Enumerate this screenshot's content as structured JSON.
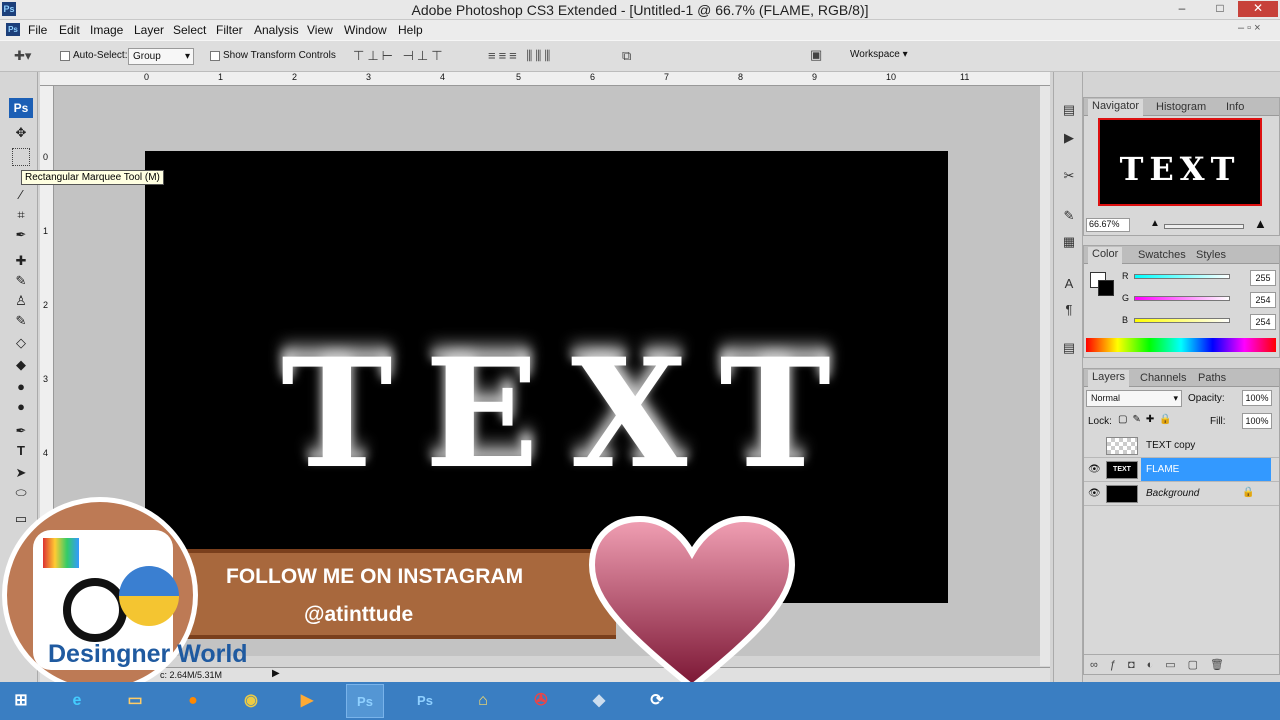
{
  "window": {
    "title": "Adobe Photoshop CS3 Extended - [Untitled-1 @ 66.7% (FLAME, RGB/8)]",
    "app_icon": "Ps"
  },
  "menu": [
    "File",
    "Edit",
    "Image",
    "Layer",
    "Select",
    "Filter",
    "Analysis",
    "View",
    "Window",
    "Help"
  ],
  "options": {
    "auto_select_label": "Auto-Select:",
    "auto_select_value": "Group",
    "transform_label": "Show Transform Controls",
    "workspace_label": "Workspace ▾"
  },
  "tools_logo": "Ps",
  "tooltip": "Rectangular Marquee Tool (M)",
  "ruler_top": [
    "0",
    "1",
    "2",
    "3",
    "4",
    "5",
    "6",
    "7",
    "8",
    "9",
    "10",
    "11"
  ],
  "ruler_left": [
    "0",
    "1",
    "2",
    "3",
    "4"
  ],
  "canvas": {
    "text": "TEXT"
  },
  "status": {
    "doc": "c: 2.64M/5.31M"
  },
  "navigator": {
    "tabs": [
      "Navigator",
      "Histogram",
      "Info"
    ],
    "preview_text": "TEXT",
    "zoom": "66.67%"
  },
  "color": {
    "tabs": [
      "Color",
      "Swatches",
      "Styles"
    ],
    "channels": [
      {
        "label": "R",
        "value": "255",
        "color": "#00e0e0"
      },
      {
        "label": "G",
        "value": "254",
        "color": "#e020e0"
      },
      {
        "label": "B",
        "value": "254",
        "color": "#e0e020"
      }
    ]
  },
  "layers": {
    "tabs": [
      "Layers",
      "Channels",
      "Paths"
    ],
    "blend": "Normal",
    "opacity_label": "Opacity:",
    "opacity": "100%",
    "lock_label": "Lock:",
    "fill_label": "Fill:",
    "fill": "100%",
    "rows": [
      {
        "name": "TEXT copy",
        "visible": false,
        "selected": false
      },
      {
        "name": "FLAME",
        "visible": true,
        "selected": true
      },
      {
        "name": "Background",
        "visible": true,
        "selected": false
      }
    ]
  },
  "overlay": {
    "banner_line1": "FOLLOW ME ON INSTAGRAM",
    "banner_line2": "@atinttude",
    "logo_text": "Desingner World"
  },
  "taskbar": [
    "start-icon",
    "ie-icon",
    "explorer-icon",
    "firefox-icon",
    "chrome-icon",
    "media-icon",
    "Ps",
    "Ps",
    "cleaner-icon",
    "ccleaner-icon",
    "app-icon",
    "sync-icon"
  ]
}
